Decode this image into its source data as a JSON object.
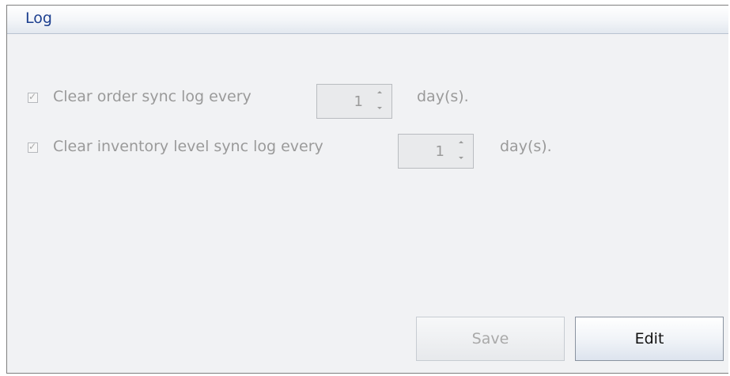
{
  "panel": {
    "title": "Log"
  },
  "settings": [
    {
      "checked": true,
      "label": "Clear order sync log every",
      "value": "1",
      "unit": "day(s)."
    },
    {
      "checked": true,
      "label": "Clear inventory level sync log every",
      "value": "1",
      "unit": "day(s)."
    }
  ],
  "buttons": {
    "save_label": "Save",
    "edit_label": "Edit"
  },
  "colors": {
    "title_text": "#1c3f8f",
    "panel_background": "#f1f2f4",
    "disabled_text": "#9a9a9a"
  },
  "icons": {
    "checkbox_mark": "✓"
  },
  "state": {
    "form_disabled": true,
    "save_enabled": false
  }
}
